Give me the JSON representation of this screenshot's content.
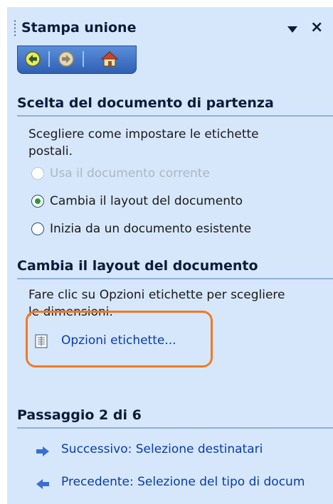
{
  "pane": {
    "title": "Stampa unione"
  },
  "nav": {
    "back_icon": "back-arrow-icon",
    "forward_icon": "forward-arrow-icon",
    "home_icon": "home-icon"
  },
  "section1": {
    "heading": "Scelta del documento di partenza",
    "instructions": "Scegliere come impostare le etichette postali.",
    "options": [
      {
        "label": "Usa il documento corrente",
        "state": "disabled"
      },
      {
        "label": "Cambia il layout del documento",
        "state": "checked"
      },
      {
        "label": "Inizia da un documento esistente",
        "state": "unchecked"
      }
    ]
  },
  "section2": {
    "heading": "Cambia il layout del documento",
    "instructions": "Fare clic su Opzioni etichette per scegliere le dimensioni.",
    "link_label": "Opzioni etichette..."
  },
  "step": {
    "heading": "Passaggio 2 di 6",
    "next_label": "Successivo: Selezione destinatari",
    "prev_label": "Precedente: Selezione del tipo di docum"
  },
  "colors": {
    "pane_bg": "#d6e7fb",
    "link": "#0a3ca8",
    "highlight": "#ef7a25"
  }
}
